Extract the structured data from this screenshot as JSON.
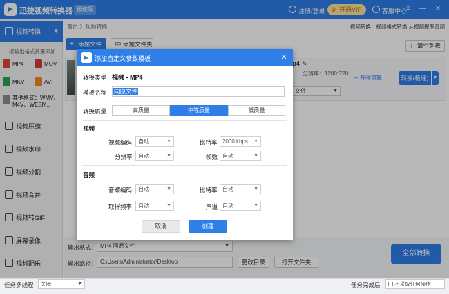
{
  "app": {
    "title": "迅捷视频转换器",
    "edition": "极速版",
    "login": "注册/登录",
    "vip": "开通VIP",
    "service": "客服中心"
  },
  "window_controls": {
    "menu": "≡",
    "minimize": "—",
    "close": "✕"
  },
  "sidebar": {
    "active_item": {
      "label": "视频转换"
    },
    "batch_note": "按输出格式批量添加",
    "formats": [
      {
        "label": "MP4",
        "color": "#e0483a"
      },
      {
        "label": "MOV",
        "color": "#d23c3c"
      },
      {
        "label": "MKV",
        "color": "#2aa64d"
      },
      {
        "label": "AVI",
        "color": "#f08a1c"
      }
    ],
    "other_formats": "其他格式：WMV、M4V、WEBM...",
    "items": [
      {
        "label": "视频压缩"
      },
      {
        "label": "视频水印"
      },
      {
        "label": "视频分割"
      },
      {
        "label": "视频合并"
      },
      {
        "label": "视频转GIF"
      },
      {
        "label": "屏幕录像"
      },
      {
        "label": "视频配乐"
      }
    ]
  },
  "main": {
    "breadcrumb": "首页 〉视频转换",
    "tagline": "视频转换：视频格式转换 从视频提取音频",
    "add_file": "添加文件",
    "add_folder": "添加文件夹",
    "clear_list": "清空列表",
    "file": {
      "name": "p4",
      "resolution": "分辨率：1280*720",
      "format_value": "文件",
      "clip": "视频剪辑",
      "convert": "转换(极速)"
    }
  },
  "modal": {
    "title": "添加自定义参数模板",
    "type_label": "转换类型",
    "type_value": "视频 - MP4",
    "name_label": "模板名称",
    "name_value": "同原文件",
    "quality_label": "转换质量",
    "quality_options": [
      "高质量",
      "中等质量",
      "低质量"
    ],
    "quality_selected_index": 1,
    "video_section": "视频",
    "audio_section": "音频",
    "video_fields": [
      {
        "label": "视频编码",
        "value": "自动"
      },
      {
        "label": "比特率",
        "value": "2000 kbps"
      },
      {
        "label": "分辨率",
        "value": "自动"
      },
      {
        "label": "帧数",
        "value": "自动"
      }
    ],
    "audio_fields": [
      {
        "label": "音频编码",
        "value": "自动"
      },
      {
        "label": "比特率",
        "value": "自动"
      },
      {
        "label": "取样频率",
        "value": "自动"
      },
      {
        "label": "声道",
        "value": "自动"
      }
    ],
    "cancel": "取消",
    "create": "创建"
  },
  "bottom": {
    "output_format_label": "输出格式：",
    "output_format_value": "MP4  同原文件",
    "output_path_label": "输出路径：",
    "output_path_value": "C:\\Users\\Administrator\\Desktop",
    "change_dir": "更改目录",
    "open_folder": "打开文件夹",
    "convert_all": "全部转换"
  },
  "status": {
    "multithread_label": "任务多线程",
    "multithread_value": "关闭",
    "done_label": "任务完成后",
    "done_value": "不采取任何操作"
  },
  "colors": {
    "accent": "#2e7fe8",
    "vip": "#ffe49a"
  }
}
